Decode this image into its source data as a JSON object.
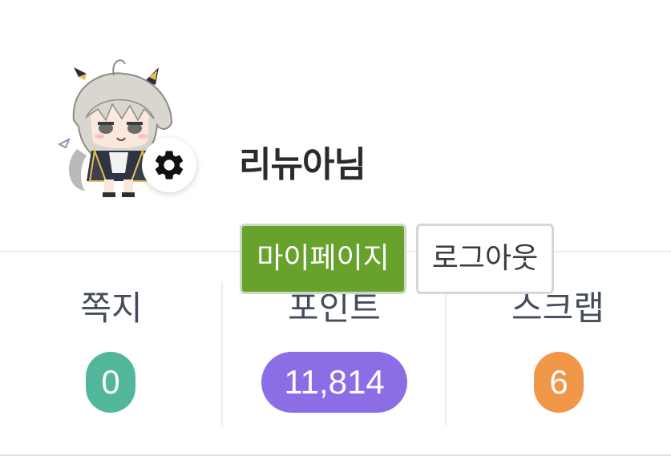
{
  "profile": {
    "username": "리뉴아님",
    "avatar_icon": "chibi-character-avatar",
    "settings_icon": "gear-icon"
  },
  "actions": {
    "mypage_label": "마이페이지",
    "logout_label": "로그아웃"
  },
  "stats": [
    {
      "label": "쪽지",
      "value": "0",
      "color": "#52b79a"
    },
    {
      "label": "포인트",
      "value": "11,814",
      "color": "#8b6ee6"
    },
    {
      "label": "스크랩",
      "value": "6",
      "color": "#f0974a"
    }
  ],
  "colors": {
    "mypage_button": "#67a22c",
    "text_dark": "#2b2b2b"
  }
}
